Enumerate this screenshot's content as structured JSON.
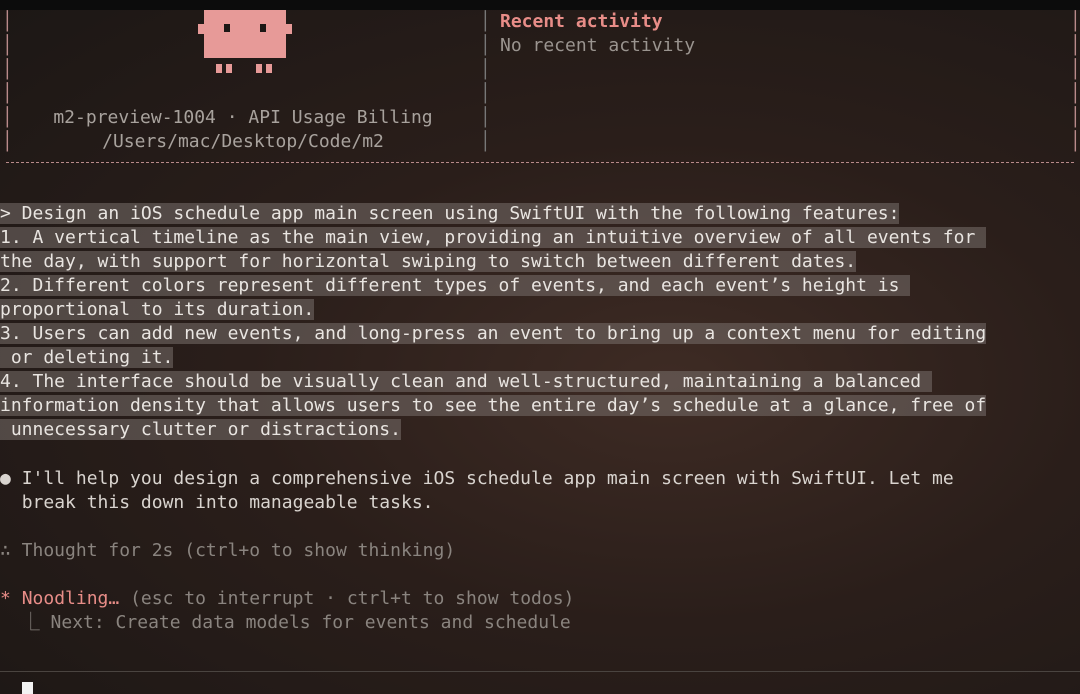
{
  "header": {
    "project": "m2-preview-1004 · API Usage Billing",
    "path": "/Users/mac/Desktop/Code/m2"
  },
  "activity": {
    "title": "Recent activity",
    "text": "No recent activity"
  },
  "prompt": {
    "lines": [
      "> Design an iOS schedule app main screen using SwiftUI with the following features:",
      "1. A vertical timeline as the main view, providing an intuitive overview of all events for ",
      "the day, with support for horizontal swiping to switch between different dates.",
      "2. Different colors represent different types of events, and each event’s height is ",
      "proportional to its duration.",
      "3. Users can add new events, and long-press an event to bring up a context menu for editing",
      " or deleting it.",
      "4. The interface should be visually clean and well-structured, maintaining a balanced ",
      "information density that allows users to see the entire day’s schedule at a glance, free of",
      " unnecessary clutter or distractions."
    ]
  },
  "response": {
    "bullet": "●",
    "line1": "I'll help you design a comprehensive iOS schedule app main screen with SwiftUI. Let me",
    "line2": "break this down into manageable tasks."
  },
  "thought": "∴ Thought for 2s (ctrl+o to show thinking)",
  "status": {
    "star": "*",
    "label": "Noodling…",
    "hint": "(esc to interrupt · ctrl+t to show todos)",
    "next_prefix": "⎿",
    "next": "Next: Create data models for events and schedule"
  },
  "colors": {
    "accent": "#e88d88",
    "mascot": "#e79a98"
  }
}
